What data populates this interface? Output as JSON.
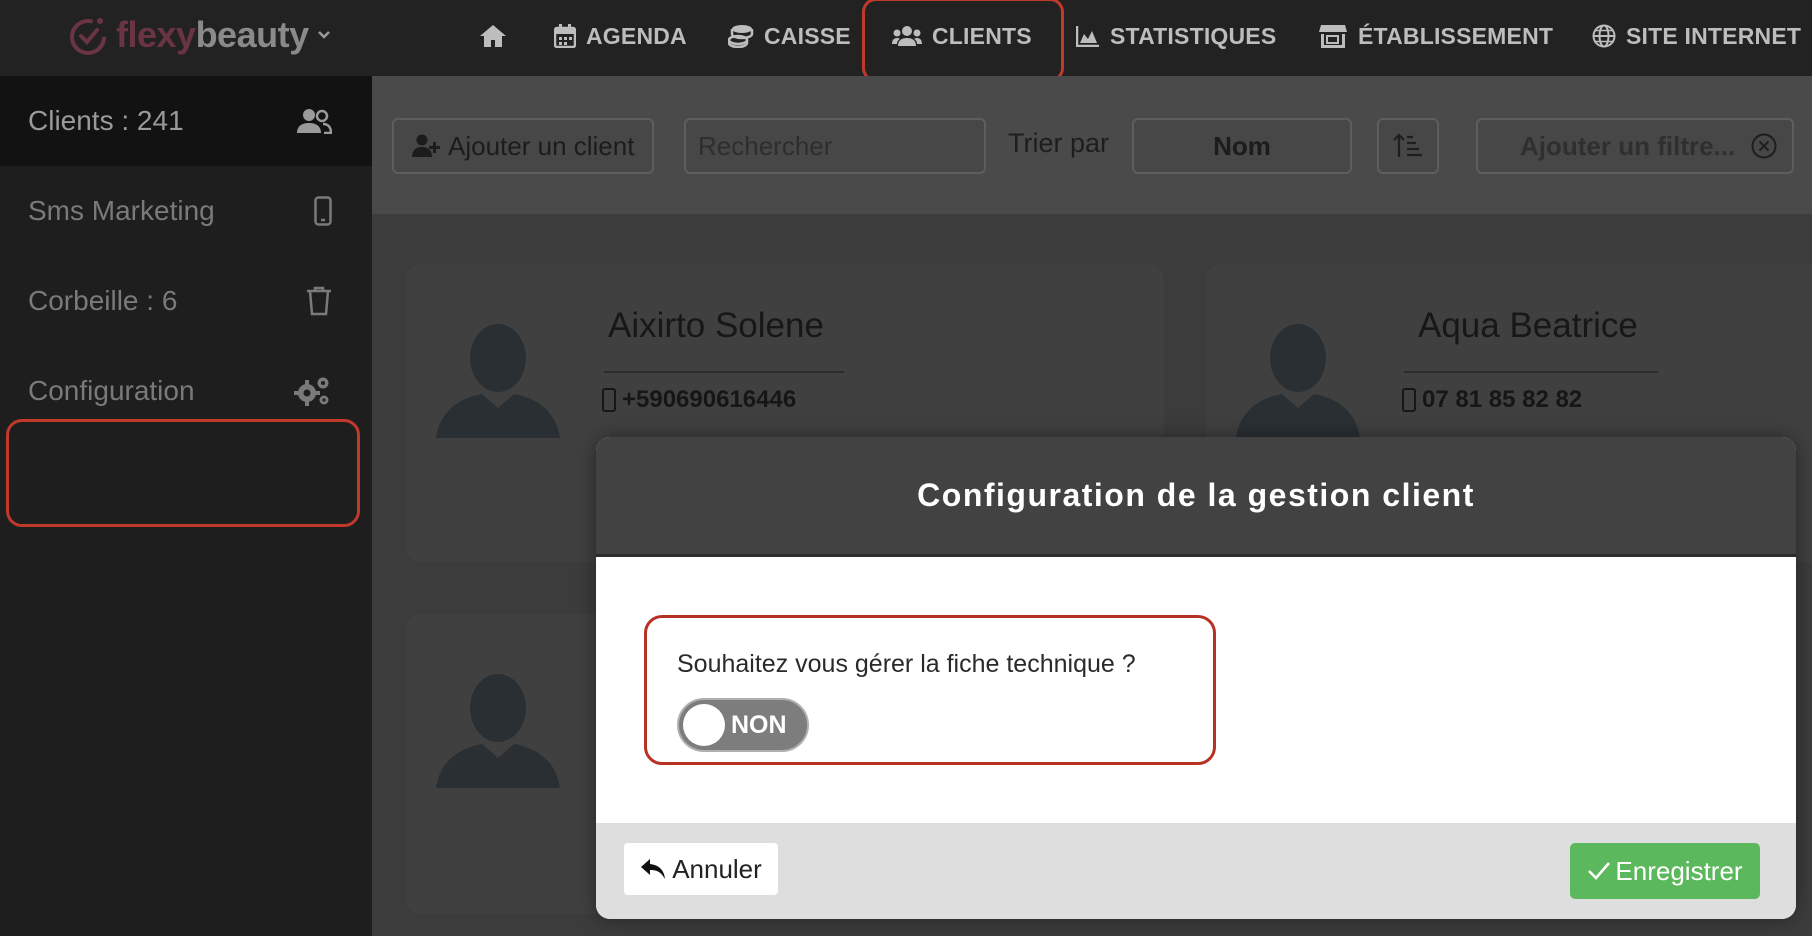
{
  "brand": {
    "part1": "flexy",
    "part2": "beauty"
  },
  "nav": [
    {
      "key": "home",
      "label": ""
    },
    {
      "key": "agenda",
      "label": "AGENDA"
    },
    {
      "key": "caisse",
      "label": "CAISSE"
    },
    {
      "key": "clients",
      "label": "CLIENTS"
    },
    {
      "key": "statistiques",
      "label": "STATISTIQUES"
    },
    {
      "key": "etablissement",
      "label": "ÉTABLISSEMENT"
    },
    {
      "key": "site",
      "label": "SITE INTERNET"
    }
  ],
  "sidebar": {
    "items": [
      {
        "label": "Clients : 241",
        "icon": "users-icon"
      },
      {
        "label": "Sms Marketing",
        "icon": "phone-icon"
      },
      {
        "label": "Corbeille : 6",
        "icon": "trash-icon"
      },
      {
        "label": "Configuration",
        "icon": "gears-icon"
      }
    ]
  },
  "toolbar": {
    "add_label": "Ajouter un client",
    "search_placeholder": "Rechercher",
    "sort_label": "Trier par",
    "sort_value": "Nom",
    "filter_placeholder": "Ajouter un filtre..."
  },
  "clients": [
    {
      "name": "Aixirto Solene",
      "phone": "+590690616446"
    },
    {
      "name": "Aqua Beatrice",
      "phone": "07 81 85 82 82"
    }
  ],
  "modal": {
    "title": "Configuration de la gestion client",
    "question": "Souhaitez vous gérer la fiche technique ?",
    "toggle_label": "NON",
    "cancel_label": "Annuler",
    "save_label": "Enregistrer"
  },
  "colors": {
    "highlight": "#c0392b",
    "save_green": "#5cb85c",
    "nav_bg": "#222222",
    "modal_header": "#424242"
  }
}
